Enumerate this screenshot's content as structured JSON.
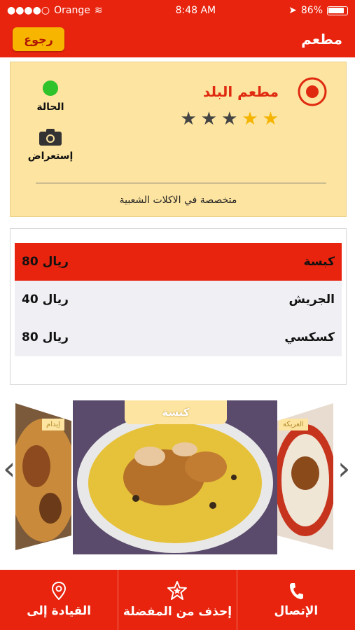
{
  "status_bar": {
    "carrier": "Orange",
    "time": "8:48 AM",
    "battery": "86%"
  },
  "nav": {
    "back_label": "رجوع",
    "title": "مطعم"
  },
  "restaurant": {
    "name": "مطعم البلد",
    "rating": 2,
    "rating_max": 5,
    "status_label": "الحالة",
    "status_color": "#2ec22b",
    "browse_label": "إستعراض",
    "specialty": "متخصصة في الاكلات الشعبية"
  },
  "menu": {
    "items": [
      {
        "name": "كبسة",
        "price": "80 ريال",
        "selected": true
      },
      {
        "name": "الجريش",
        "price": "40 ريال",
        "selected": false
      },
      {
        "name": "كسكسي",
        "price": "80 ريال",
        "selected": false
      }
    ]
  },
  "gallery": {
    "left_label": "إيدام",
    "center_label": "كبسة",
    "right_label": "العريكة"
  },
  "actions": {
    "call": "الإتصال",
    "favorite": "إحذف من المفضلة",
    "navigate": "القيادة إلى"
  },
  "colors": {
    "primary": "#e8240e",
    "accent": "#f7b500",
    "card": "#fde4a0"
  }
}
